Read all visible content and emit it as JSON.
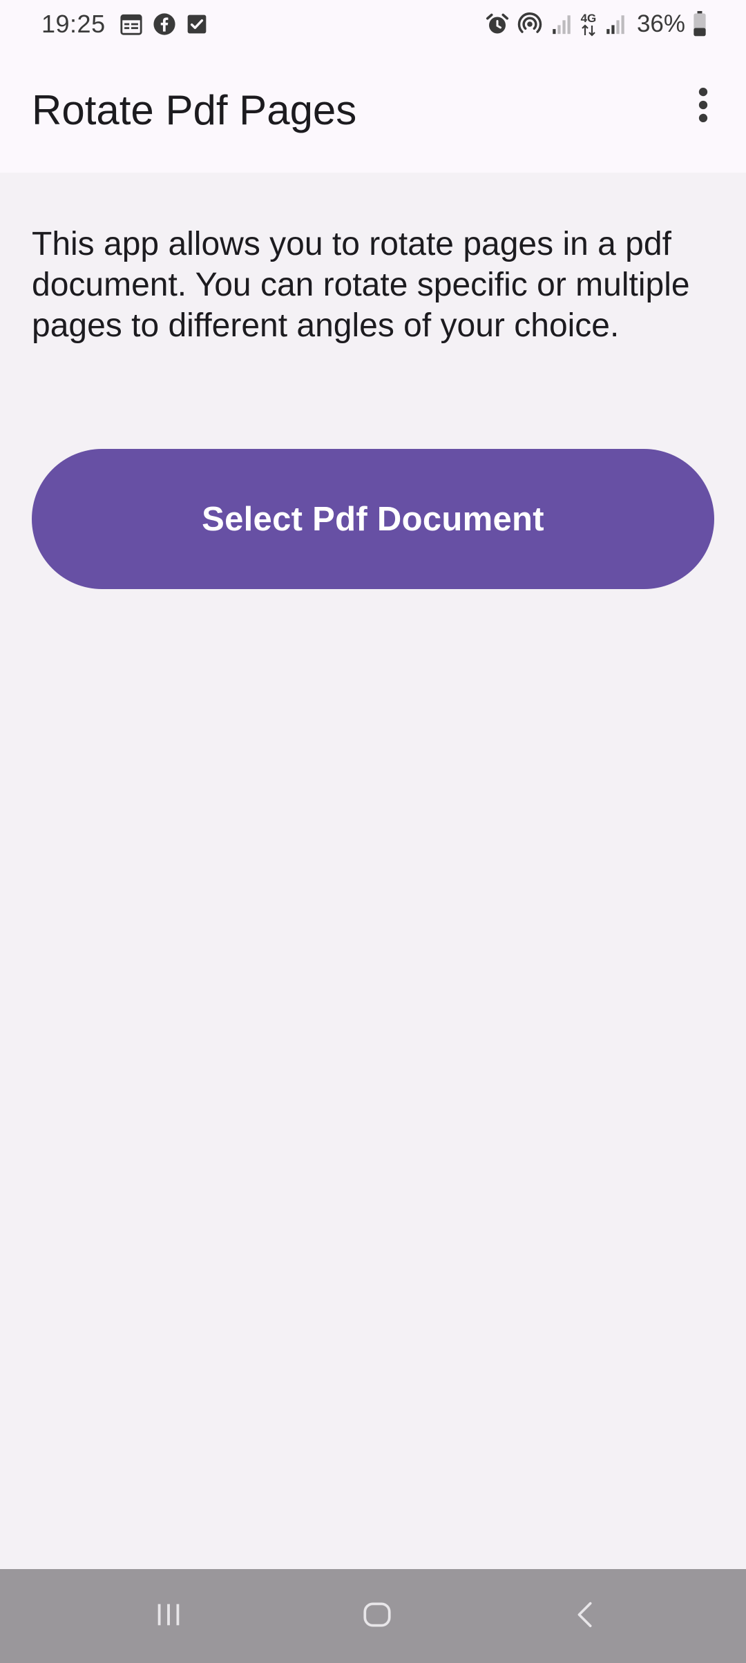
{
  "status_bar": {
    "time": "19:25",
    "battery_percent": "36%",
    "network_type": "4G",
    "battery_level": 0.36,
    "left_icons": [
      "calendar-icon",
      "facebook-icon",
      "task-check-icon"
    ],
    "right_icons": [
      "alarm-icon",
      "hotspot-icon",
      "signal-weak-icon",
      "network-4g-icon",
      "signal-icon",
      "battery-icon"
    ]
  },
  "app_bar": {
    "title": "Rotate Pdf Pages",
    "menu_icon": "more-vert-icon"
  },
  "main": {
    "description": "This app allows you to rotate pages in a pdf document. You can rotate specific or multiple pages to different angles of your choice.",
    "select_button_label": "Select Pdf Document"
  },
  "nav_bar": {
    "icons": [
      "recent-apps-icon",
      "home-icon",
      "back-icon"
    ]
  },
  "colors": {
    "accent": "#6750a4",
    "app_bar_bg": "#fcf8fd",
    "content_bg": "#f4f1f5",
    "nav_bar_bg": "#9a979b"
  }
}
